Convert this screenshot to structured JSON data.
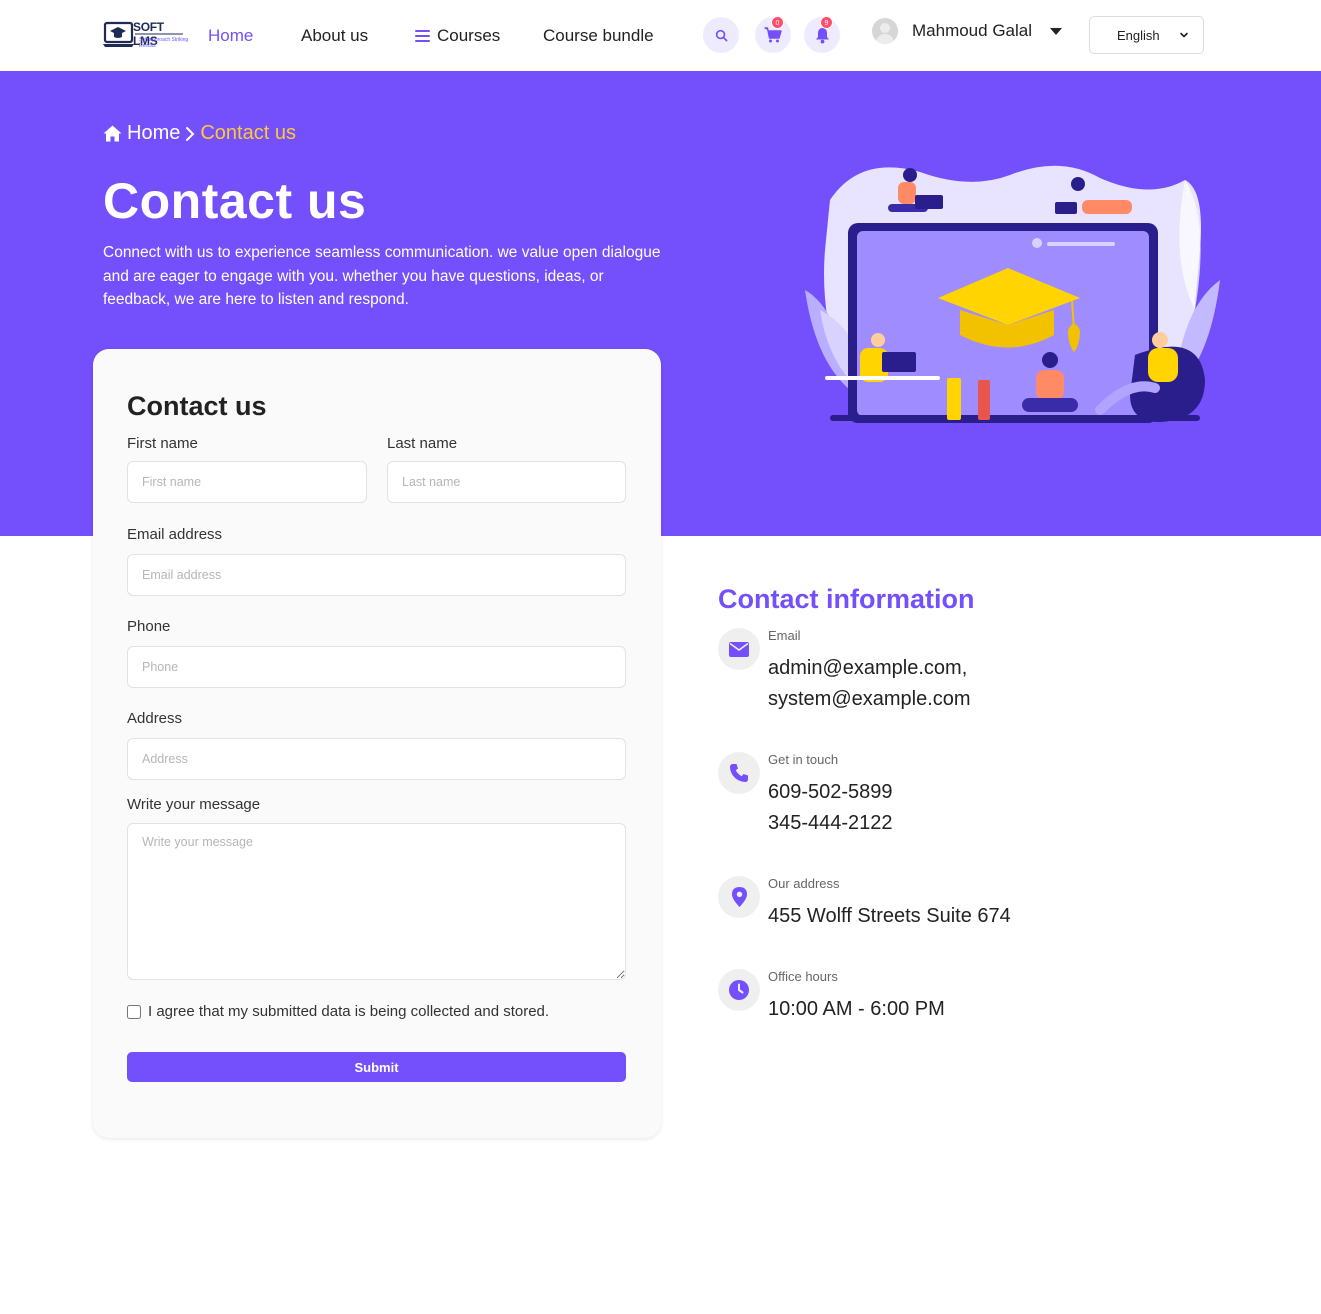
{
  "nav": {
    "logo": {
      "name": "SOFT LMS",
      "tagline": "Soft approach Striking Results"
    },
    "links": {
      "home": "Home",
      "about": "About us",
      "courses": "Courses",
      "bundle": "Course bundle"
    },
    "cart_count": "0",
    "notification_count": "9",
    "user_name": "Mahmoud Galal",
    "language": "English",
    "accent_color": "#7350fc"
  },
  "hero": {
    "breadcrumb": {
      "home": "Home",
      "current": "Contact us"
    },
    "title": "Contact us",
    "description": "Connect with us to experience seamless communication. we value open dialogue and are eager to engage with you. whether you have questions, ideas, or feedback, we are here to listen and respond.",
    "background_color": "#7350fc",
    "highlight_color": "#ffc83a"
  },
  "form": {
    "title": "Contact us",
    "first_name": {
      "label": "First name",
      "placeholder": "First name",
      "value": ""
    },
    "last_name": {
      "label": "Last name",
      "placeholder": "Last name",
      "value": ""
    },
    "email": {
      "label": "Email address",
      "placeholder": "Email address",
      "value": ""
    },
    "phone": {
      "label": "Phone",
      "placeholder": "Phone",
      "value": ""
    },
    "address": {
      "label": "Address",
      "placeholder": "Address",
      "value": ""
    },
    "message": {
      "label": "Write your message",
      "placeholder": "Write your message",
      "value": ""
    },
    "agree_text": "I agree that my submitted data is being collected and stored.",
    "agree_checked": false,
    "submit_label": "Submit"
  },
  "contact_info": {
    "title": "Contact information",
    "email": {
      "label": "Email",
      "line1": "admin@example.com,",
      "line2": "system@example.com",
      "icon": "envelope-icon"
    },
    "phone": {
      "label": "Get in touch",
      "line1": "609-502-5899",
      "line2": "345-444-2122",
      "icon": "phone-icon"
    },
    "address": {
      "label": "Our address",
      "line1": "455 Wolff Streets Suite 674",
      "icon": "map-pin-icon"
    },
    "hours": {
      "label": "Office hours",
      "line1": "10:00 AM - 6:00 PM",
      "icon": "clock-icon"
    }
  }
}
